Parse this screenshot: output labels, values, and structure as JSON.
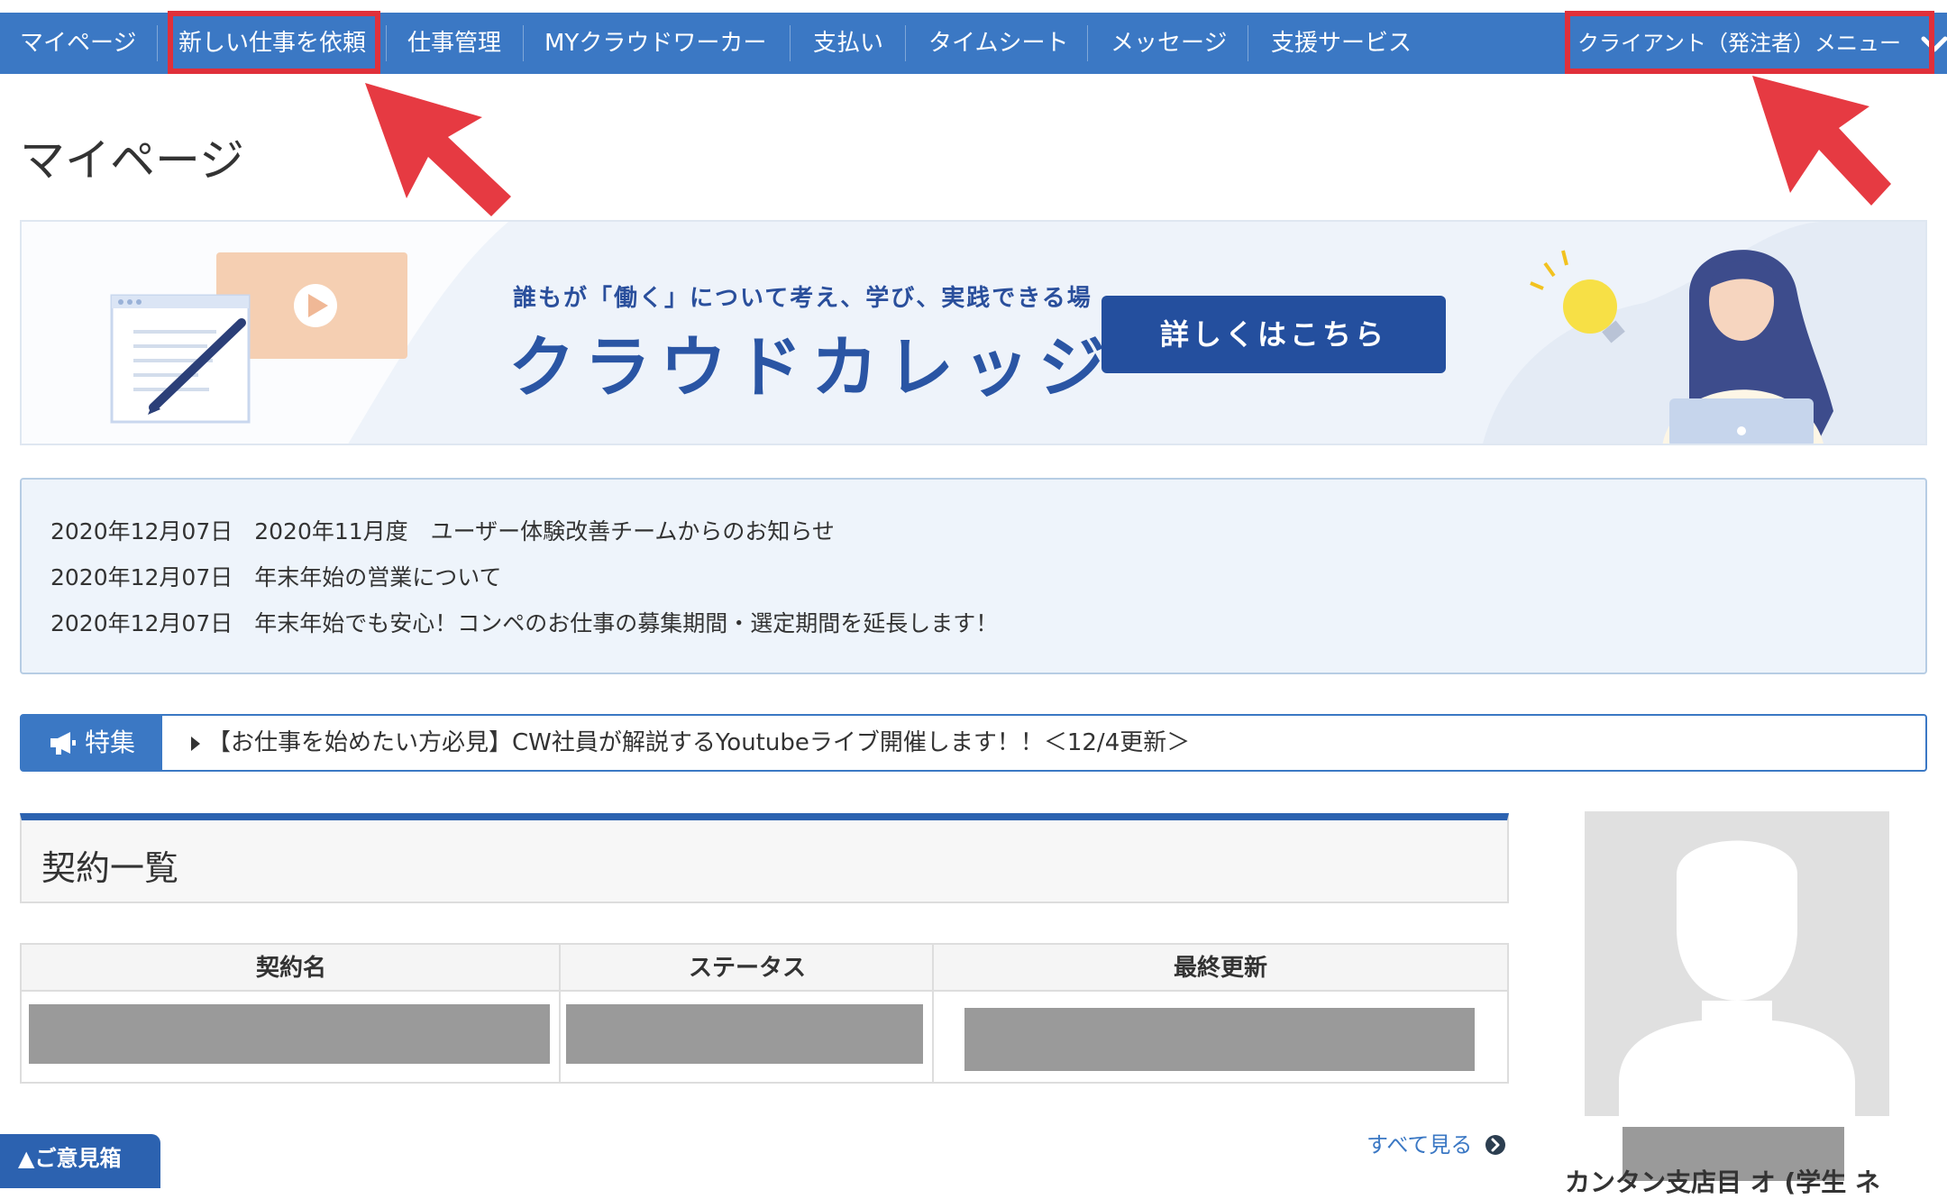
{
  "nav": {
    "items": [
      "マイページ",
      "新しい仕事を依頼",
      "仕事管理",
      "MYクラウドワーカー",
      "支払い",
      "タイムシート",
      "メッセージ",
      "支援サービス"
    ],
    "client_menu": "クライアント（発注者）メニュー"
  },
  "page_title": "マイページ",
  "banner": {
    "tagline": "誰もが「働く」について考え、学び、実践できる場",
    "title": "クラウドカレッジ",
    "button": "詳しくはこちら"
  },
  "news": [
    {
      "date": "2020年12月07日",
      "title": "2020年11月度　ユーザー体験改善チームからのお知らせ"
    },
    {
      "date": "2020年12月07日",
      "title": "年末年始の営業について"
    },
    {
      "date": "2020年12月07日",
      "title": "年末年始でも安心！コンペのお仕事の募集期間・選定期間を延長します！"
    }
  ],
  "feature": {
    "label": "特集",
    "link": "【お仕事を始めたい方必見】CW社員が解説するYoutubeライブ開催します！！＜12/4更新＞"
  },
  "contracts": {
    "heading": "契約一覧",
    "columns": [
      "契約名",
      "ステータス",
      "最終更新"
    ],
    "see_all": "すべて見る"
  },
  "profile": {
    "name_partial": "カンタン支店目 オ (学生 ネ"
  },
  "feedback": "▲ご意見箱",
  "colors": {
    "nav_bg": "#3b78c4",
    "highlight": "#e0303a",
    "banner_button": "#244f9e",
    "accent": "#2c62b0"
  }
}
